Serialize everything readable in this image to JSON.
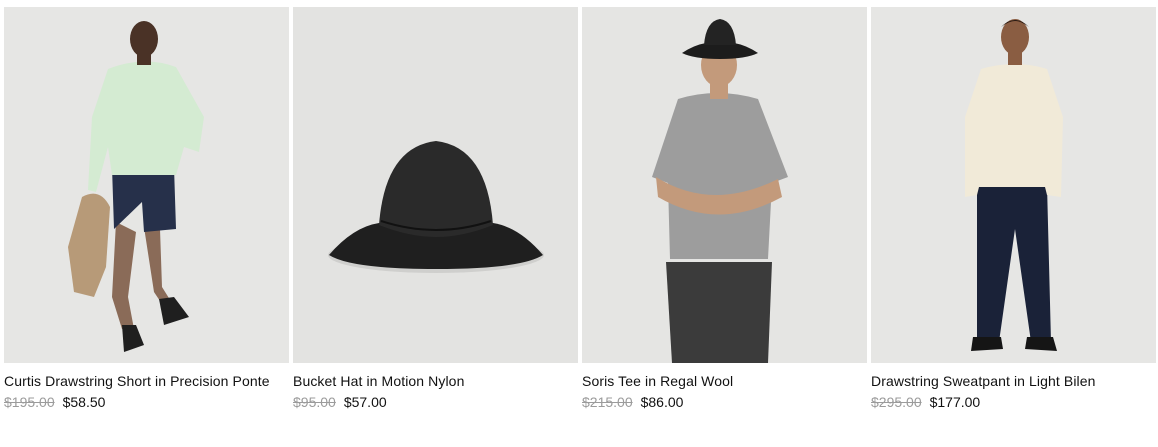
{
  "colors": {
    "background": "#ffffff",
    "text": "#111111",
    "strikethrough_price": "#9b9b9b",
    "photo_background": "#e4e4e2"
  },
  "products": [
    {
      "name": "Curtis Drawstring Short in Precision Ponte",
      "original_price": "$195.00",
      "sale_price": "$58.50",
      "image_icon": "model-wearing-green-sweater-navy-shorts"
    },
    {
      "name": "Bucket Hat in Motion Nylon",
      "original_price": "$95.00",
      "sale_price": "$57.00",
      "image_icon": "black-bucket-hat"
    },
    {
      "name": "Soris Tee in Regal Wool",
      "original_price": "$215.00",
      "sale_price": "$86.00",
      "image_icon": "model-wearing-grey-tee-bucket-hat"
    },
    {
      "name": "Drawstring Sweatpant in Light Bilen",
      "original_price": "$295.00",
      "sale_price": "$177.00",
      "image_icon": "model-wearing-cream-sweater-navy-pants"
    }
  ]
}
